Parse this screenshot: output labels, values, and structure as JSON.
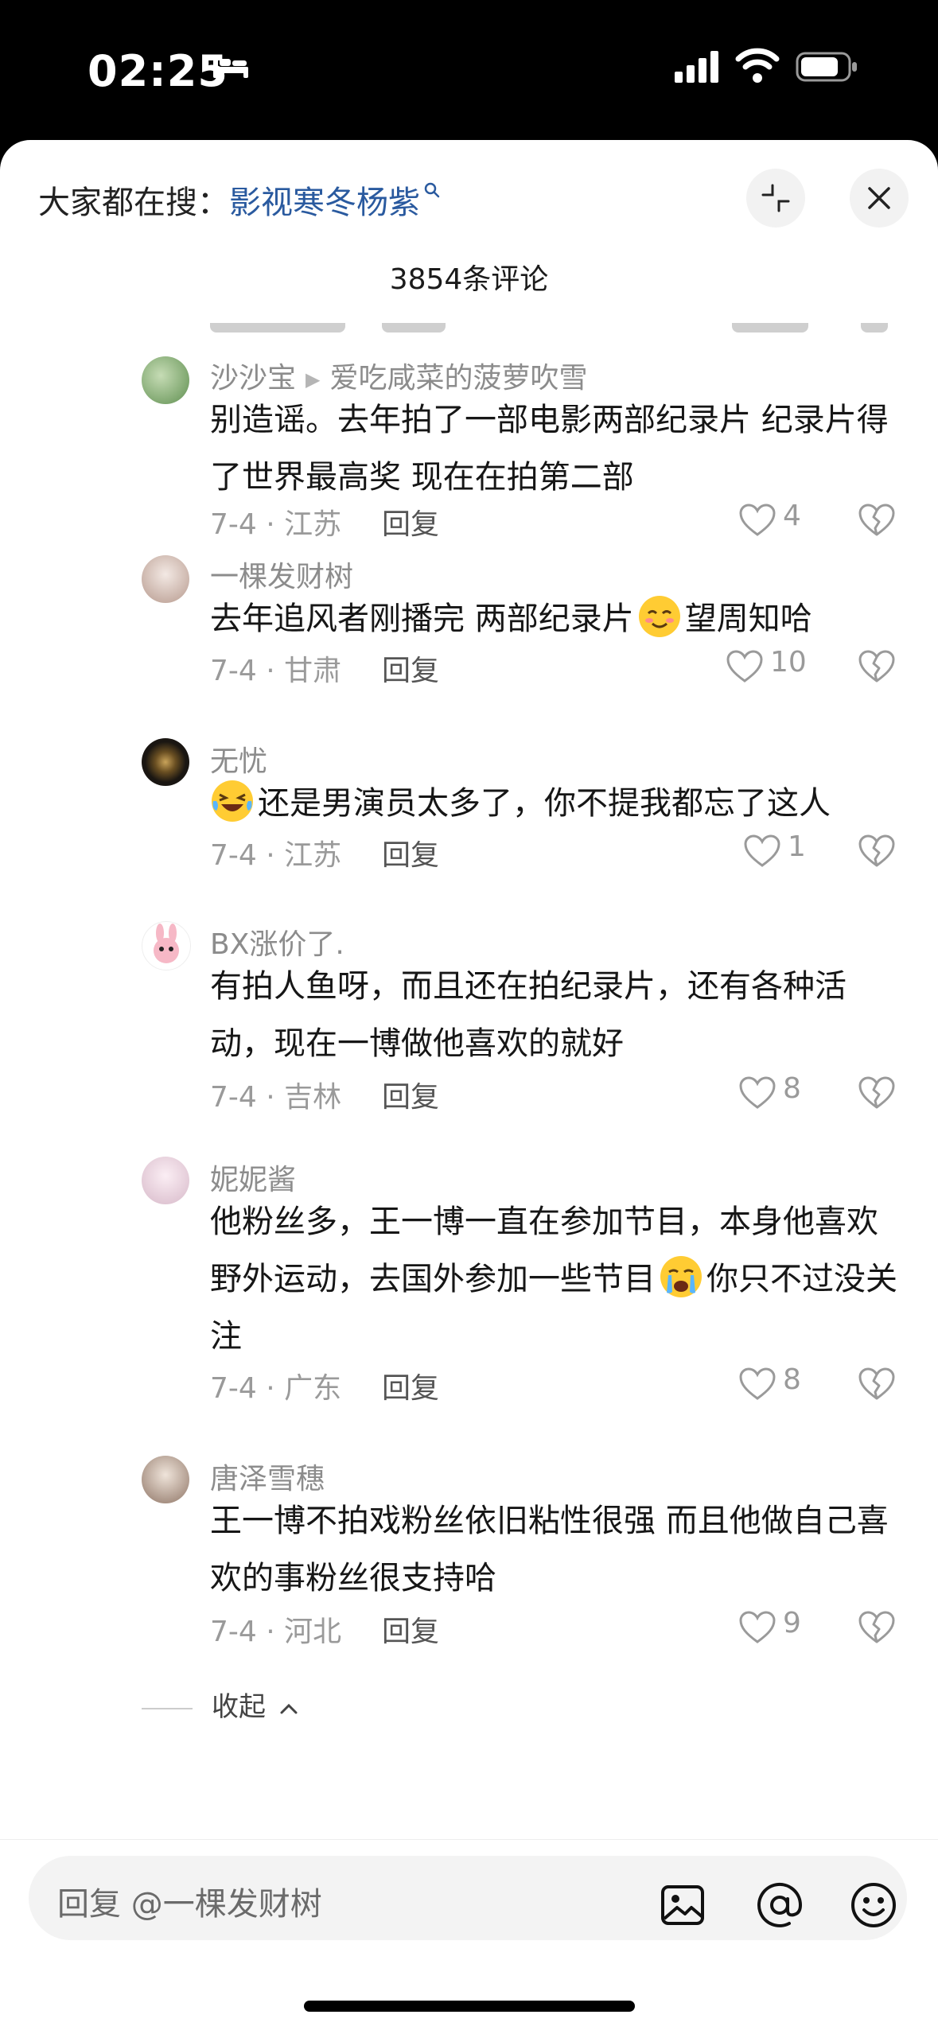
{
  "status_bar": {
    "time": "02:25"
  },
  "header": {
    "search_prefix": "大家都在搜：",
    "search_keyword": "影视寒冬杨紫",
    "comment_count": "3854条评论"
  },
  "comments": [
    {
      "user": "沙沙宝",
      "reply_to": "爱吃咸菜的菠萝吹雪",
      "text": "别造谣。去年拍了一部电影两部纪录片 纪录片得了世界最高奖 现在在拍第二部",
      "date_loc": "7-4 · 江苏",
      "reply_label": "回复",
      "likes": "4",
      "avatar_color": "#8fb27a"
    },
    {
      "user": "一棵发财树",
      "text_before": "去年追风者刚播完 两部纪录片",
      "emoji": "blush",
      "text_after": "望周知哈",
      "date_loc": "7-4 · 甘肃",
      "reply_label": "回复",
      "likes": "10",
      "avatar_color": "#d8c8c0"
    },
    {
      "user": "无忧",
      "emoji": "laugh",
      "text_after": "还是男演员太多了，你不提我都忘了这人",
      "date_loc": "7-4 · 江苏",
      "reply_label": "回复",
      "likes": "1",
      "avatar_color": "#2b2620"
    },
    {
      "user": "BX涨价了.",
      "text": "有拍人鱼呀，而且还在拍纪录片，还有各种活动，现在一博做他喜欢的就好",
      "date_loc": "7-4 · 吉林",
      "reply_label": "回复",
      "likes": "8",
      "avatar_color": "#f4d6dc"
    },
    {
      "user": "妮妮酱",
      "text_before": "他粉丝多，王一博一直在参加节目，本身他喜欢野外运动，去国外参加一些节目",
      "emoji": "cry",
      "text_after": "你只不过没关注",
      "date_loc": "7-4 · 广东",
      "reply_label": "回复",
      "likes": "8",
      "avatar_color": "#eadbe6"
    },
    {
      "user": "唐泽雪穗",
      "text": "王一博不拍戏粉丝依旧粘性很强 而且他做自己喜欢的事粉丝很支持哈",
      "date_loc": "7-4 · 河北",
      "reply_label": "回复",
      "likes": "9",
      "avatar_color": "#c9b9ad"
    }
  ],
  "collapse_label": "收起",
  "bottom_bar": {
    "input_placeholder": "回复 @一棵发财树"
  }
}
